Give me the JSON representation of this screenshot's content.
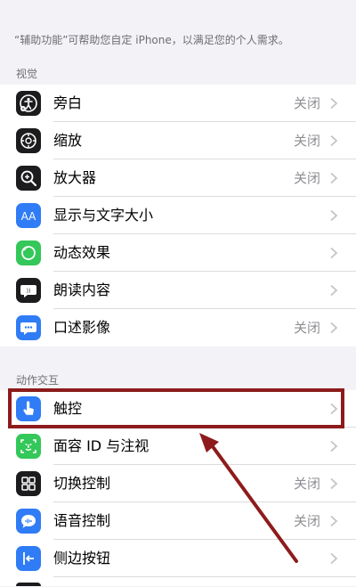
{
  "intro_text": "“辅助功能”可帮助您自定 iPhone，以满足您的个人需求。",
  "sections": [
    {
      "header": "视觉",
      "rows": [
        {
          "label": "旁白",
          "value": "关闭",
          "icon": "voiceover-icon",
          "color": "#1c1c1e"
        },
        {
          "label": "缩放",
          "value": "关闭",
          "icon": "zoom-icon",
          "color": "#1c1c1e"
        },
        {
          "label": "放大器",
          "value": "关闭",
          "icon": "magnifier-icon",
          "color": "#1c1c1e"
        },
        {
          "label": "显示与文字大小",
          "value": "",
          "icon": "text-size-icon",
          "color": "#2f7cf6"
        },
        {
          "label": "动态效果",
          "value": "",
          "icon": "motion-icon",
          "color": "#34c759"
        },
        {
          "label": "朗读内容",
          "value": "",
          "icon": "speech-icon",
          "color": "#1c1c1e"
        },
        {
          "label": "口述影像",
          "value": "关闭",
          "icon": "audio-description-icon",
          "color": "#2f7cf6"
        }
      ]
    },
    {
      "header": "动作交互",
      "rows": [
        {
          "label": "触控",
          "value": "",
          "icon": "touch-icon",
          "color": "#2f7cf6"
        },
        {
          "label": "面容 ID 与注视",
          "value": "",
          "icon": "face-id-icon",
          "color": "#34c759"
        },
        {
          "label": "切换控制",
          "value": "关闭",
          "icon": "switch-control-icon",
          "color": "#1c1c1e"
        },
        {
          "label": "语音控制",
          "value": "关闭",
          "icon": "voice-control-icon",
          "color": "#2f7cf6"
        },
        {
          "label": "侧边按钮",
          "value": "",
          "icon": "side-button-icon",
          "color": "#2f7cf6"
        }
      ]
    }
  ],
  "highlight_color": "#8e1b1b"
}
